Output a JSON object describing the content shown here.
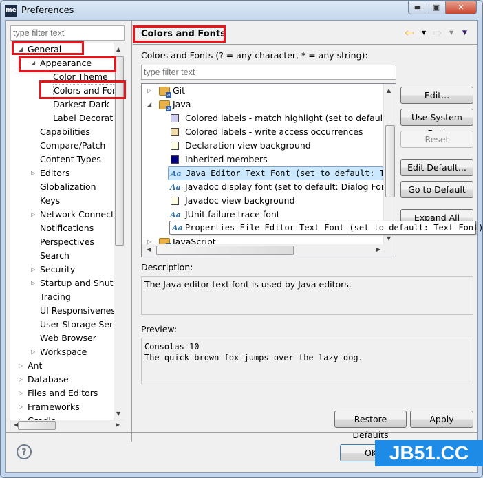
{
  "window": {
    "title": "Preferences",
    "logo": "me",
    "controls": [
      "minimize",
      "maximize",
      "close"
    ]
  },
  "left": {
    "filter_placeholder": "type filter text",
    "tree": [
      {
        "label": "General",
        "level": 0,
        "state": "expanded"
      },
      {
        "label": "Appearance",
        "level": 1,
        "state": "expanded"
      },
      {
        "label": "Color Theme",
        "level": 2
      },
      {
        "label": "Colors and Fonts",
        "level": 2,
        "selected": true
      },
      {
        "label": "Darkest Dark",
        "level": 2
      },
      {
        "label": "Label Decorations",
        "level": 2
      },
      {
        "label": "Capabilities",
        "level": 1
      },
      {
        "label": "Compare/Patch",
        "level": 1
      },
      {
        "label": "Content Types",
        "level": 1
      },
      {
        "label": "Editors",
        "level": 1,
        "state": "collapsed"
      },
      {
        "label": "Globalization",
        "level": 1
      },
      {
        "label": "Keys",
        "level": 1
      },
      {
        "label": "Network Connections",
        "level": 1,
        "state": "collapsed"
      },
      {
        "label": "Notifications",
        "level": 1
      },
      {
        "label": "Perspectives",
        "level": 1
      },
      {
        "label": "Search",
        "level": 1
      },
      {
        "label": "Security",
        "level": 1,
        "state": "collapsed"
      },
      {
        "label": "Startup and Shutdown",
        "level": 1,
        "state": "collapsed"
      },
      {
        "label": "Tracing",
        "level": 1
      },
      {
        "label": "UI Responsiveness",
        "level": 1
      },
      {
        "label": "User Storage Service",
        "level": 1
      },
      {
        "label": "Web Browser",
        "level": 1
      },
      {
        "label": "Workspace",
        "level": 1,
        "state": "collapsed"
      },
      {
        "label": "Ant",
        "level": 0,
        "state": "collapsed"
      },
      {
        "label": "Database",
        "level": 0,
        "state": "collapsed"
      },
      {
        "label": "Files and Editors",
        "level": 0,
        "state": "collapsed"
      },
      {
        "label": "Frameworks",
        "level": 0,
        "state": "collapsed"
      },
      {
        "label": "Gradle",
        "level": 0,
        "state": "collapsed"
      }
    ]
  },
  "right": {
    "header": "Colors and Fonts",
    "intro": "Colors and Fonts (? = any character, * = any string):",
    "filter_placeholder": "type filter text",
    "tree": [
      {
        "label": "Git",
        "type": "category",
        "state": "collapsed"
      },
      {
        "label": "Java",
        "type": "category",
        "state": "expanded"
      },
      {
        "label": "Colored labels - match highlight (set to default: Match highlight)",
        "type": "color",
        "color": "#cfcdf0"
      },
      {
        "label": "Colored labels - write access occurrences",
        "type": "color",
        "color": "#f0d9a8"
      },
      {
        "label": "Declaration view background",
        "type": "color",
        "color": "#fffde4"
      },
      {
        "label": "Inherited members",
        "type": "color",
        "color": "#000080"
      },
      {
        "label": "Java Editor Text Font (set to default: Text Font)",
        "type": "font",
        "selected": true,
        "mono": true
      },
      {
        "label": "Javadoc display font (set to default: Dialog Font)",
        "type": "font"
      },
      {
        "label": "Javadoc view background",
        "type": "color",
        "color": "#fffde4"
      },
      {
        "label": "JUnit failure trace font",
        "type": "font"
      },
      {
        "label": "Properties File Editor Text Font (set to default: Text Font)",
        "type": "font",
        "mono": true,
        "tooltip": true
      },
      {
        "label": "JavaScript",
        "type": "category",
        "state": "collapsed"
      }
    ],
    "buttons": {
      "edit": "Edit...",
      "use_system_font": "Use System Font",
      "reset": "Reset",
      "edit_default": "Edit Default...",
      "go_to_default": "Go to Default",
      "expand_all": "Expand All"
    },
    "description_label": "Description:",
    "description": "The Java editor text font is used by Java editors.",
    "preview_label": "Preview:",
    "preview_lines": [
      "Consolas 10",
      "The quick brown fox jumps over the lazy dog."
    ],
    "restore_defaults": "Restore Defaults",
    "apply": "Apply"
  },
  "footer": {
    "ok": "OK",
    "help_icon": "question-circle"
  },
  "watermark": "JB51.CC",
  "colors": {
    "annotation": "#e8141c",
    "watermark": "#1e8be6",
    "selection": "#cce8ff"
  }
}
